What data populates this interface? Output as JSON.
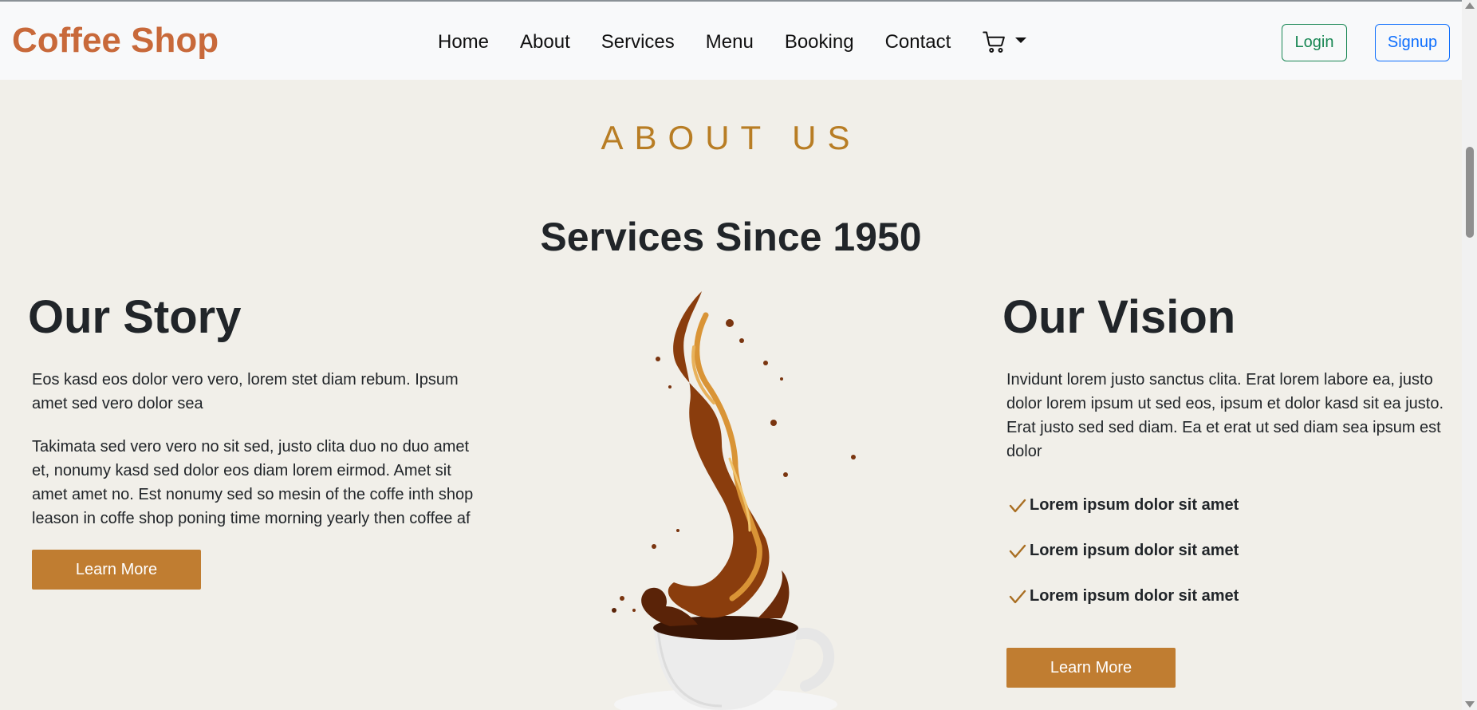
{
  "navbar": {
    "brand": "Coffee Shop",
    "links": [
      "Home",
      "About",
      "Services",
      "Menu",
      "Booking",
      "Contact"
    ],
    "cart_icon": "shopping-cart-icon",
    "login_label": "Login",
    "signup_label": "Signup"
  },
  "about": {
    "eyebrow": "ABOUT US",
    "title": "Services Since 1950",
    "story": {
      "heading": "Our Story",
      "paragraphs": [
        "Eos kasd eos dolor vero vero, lorem stet diam rebum. Ipsum amet sed vero dolor sea",
        "Takimata sed vero vero no sit sed, justo clita duo no duo amet et, nonumy kasd sed dolor eos diam lorem eirmod. Amet sit amet amet no. Est nonumy sed so mesin of the coffe inth shop leason in coffe shop poning time morning yearly then coffee af"
      ],
      "button_label": "Learn More"
    },
    "vision": {
      "heading": "Our Vision",
      "paragraph": "Invidunt lorem justo sanctus clita. Erat lorem labore ea, justo dolor lorem ipsum ut sed eos, ipsum et dolor kasd sit ea justo. Erat justo sed sed diam. Ea et erat ut sed diam sea ipsum est dolor",
      "checklist": [
        "Lorem ipsum dolor sit amet",
        "Lorem ipsum dolor sit amet",
        "Lorem ipsum dolor sit amet"
      ],
      "check_icon": "checkmark-icon",
      "button_label": "Learn More"
    },
    "image": "coffee-splash-cup-image"
  },
  "colors": {
    "brand": "#c8693a",
    "accent": "#c07d31",
    "eyebrow": "#b87d24",
    "background": "#f1efe9",
    "navbar": "#f8f9fa",
    "login": "#198754",
    "signup": "#0d6efd"
  }
}
